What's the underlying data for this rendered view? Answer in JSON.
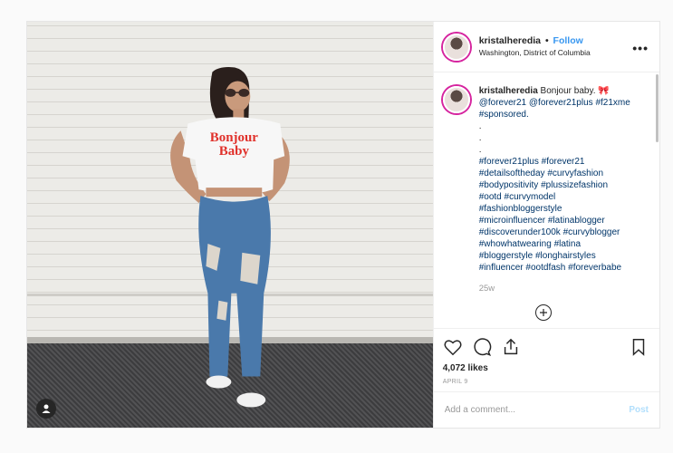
{
  "header": {
    "username": "kristalheredia",
    "separator": "•",
    "follow_label": "Follow",
    "location": "Washington, District of Columbia",
    "more_label": "•••"
  },
  "caption": {
    "username": "kristalheredia",
    "text_intro": "Bonjour baby. 🎀",
    "mentions": [
      "@forever21",
      "@forever21plus",
      "#f21xme",
      "#sponsored."
    ],
    "dots": [
      ".",
      ".",
      "."
    ],
    "hashtags": [
      "#forever21plus",
      "#forever21",
      "#detailsoftheday",
      "#curvyfashion",
      "#bodypositivity",
      "#plussizefashion",
      "#ootd",
      "#curvymodel",
      "#fashionbloggerstyle",
      "#microinfluencer",
      "#latinablogger",
      "#discoverunder100k",
      "#curvyblogger",
      "#whowhatwearing",
      "#latina",
      "#bloggerstyle",
      "#longhairstyles",
      "#influencer",
      "#ootdfash",
      "#foreverbabe"
    ],
    "age": "25w"
  },
  "shirt_text": [
    "Bonjour",
    "Baby"
  ],
  "actions": {
    "likes": "4,072 likes",
    "date": "APRIL 9"
  },
  "comment_box": {
    "placeholder": "Add a comment...",
    "post_label": "Post"
  },
  "colors": {
    "follow": "#3897f0",
    "link": "#003569",
    "post_disabled": "#b2dffc",
    "shirt_text": "#e0312b"
  },
  "icons": [
    "user-tag-icon",
    "heart-icon",
    "comment-icon",
    "share-icon",
    "bookmark-icon",
    "plus-circle-icon",
    "more-icon"
  ]
}
